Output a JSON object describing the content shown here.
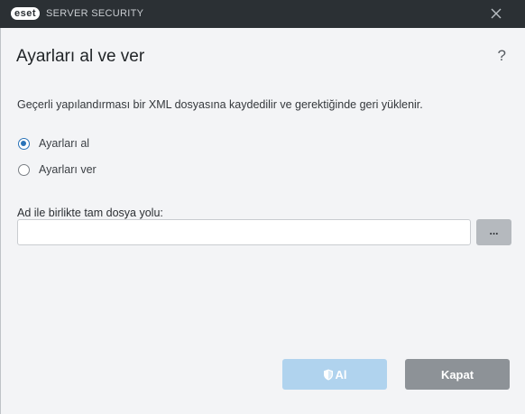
{
  "titlebar": {
    "logo_text": "eset",
    "product_name": "SERVER SECURITY"
  },
  "page": {
    "title": "Ayarları al ve ver",
    "help_label": "?",
    "description": "Geçerli yapılandırması bir XML dosyasına kaydedilir ve gerektiğinde geri yüklenir."
  },
  "options": [
    {
      "label": "Ayarları al",
      "checked": true
    },
    {
      "label": "Ayarları ver",
      "checked": false
    }
  ],
  "path_field": {
    "label": "Ad ile birlikte tam dosya yolu:",
    "value": "",
    "placeholder": "",
    "browse_label": "..."
  },
  "buttons": {
    "primary_label": "Al",
    "secondary_label": "Kapat"
  },
  "colors": {
    "titlebar": "#2b3034",
    "accent": "#2a73b8",
    "primary_button_disabled": "#b0d3ee",
    "secondary_button": "#8d9297"
  }
}
